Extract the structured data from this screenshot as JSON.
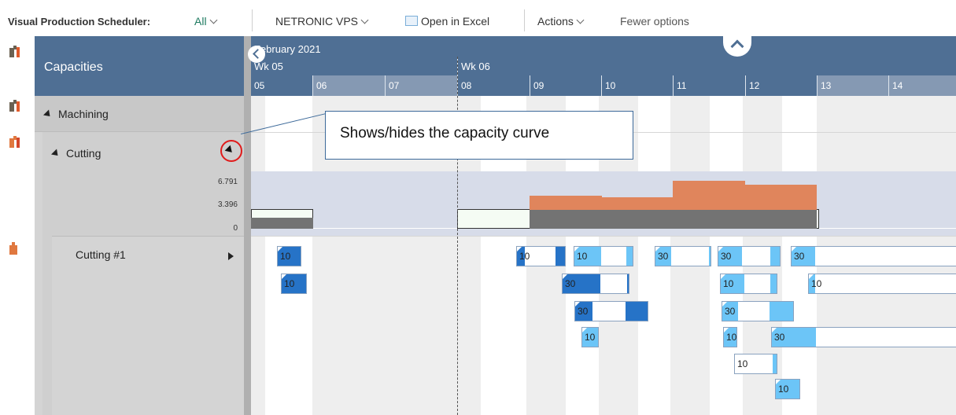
{
  "toolbar": {
    "title": "Visual Production Scheduler:",
    "filter": "All",
    "netronic": "NETRONIC VPS",
    "excel": "Open in Excel",
    "actions": "Actions",
    "fewer": "Fewer options"
  },
  "capacities": {
    "title": "Capacities",
    "machining": "Machining",
    "cutting": "Cutting",
    "cutting1": "Cutting #1",
    "scale": [
      "6.791",
      "3.396",
      "0"
    ]
  },
  "timeline": {
    "month": "February 2021",
    "weeks": [
      "Wk 05",
      "Wk 06"
    ],
    "days": [
      "05",
      "06",
      "07",
      "08",
      "09",
      "10",
      "11",
      "12",
      "13",
      "14"
    ]
  },
  "callout": "Shows/hides the capacity curve",
  "tasks": {
    "t1": "10",
    "t2": "10",
    "t3": "10",
    "t4": "10",
    "t5": "30",
    "t6": "30",
    "t7": "30",
    "t8": "30",
    "t9": "10",
    "t10": "10",
    "t11": "10",
    "t12": "30",
    "t13": "10",
    "t14": "30",
    "t15": "10",
    "t16": "30",
    "t17": "10"
  },
  "colors": {
    "header": "#4f6f94",
    "task_dark": "#2673c7",
    "task_light": "#6cc5f7",
    "load": "#e0855c"
  }
}
